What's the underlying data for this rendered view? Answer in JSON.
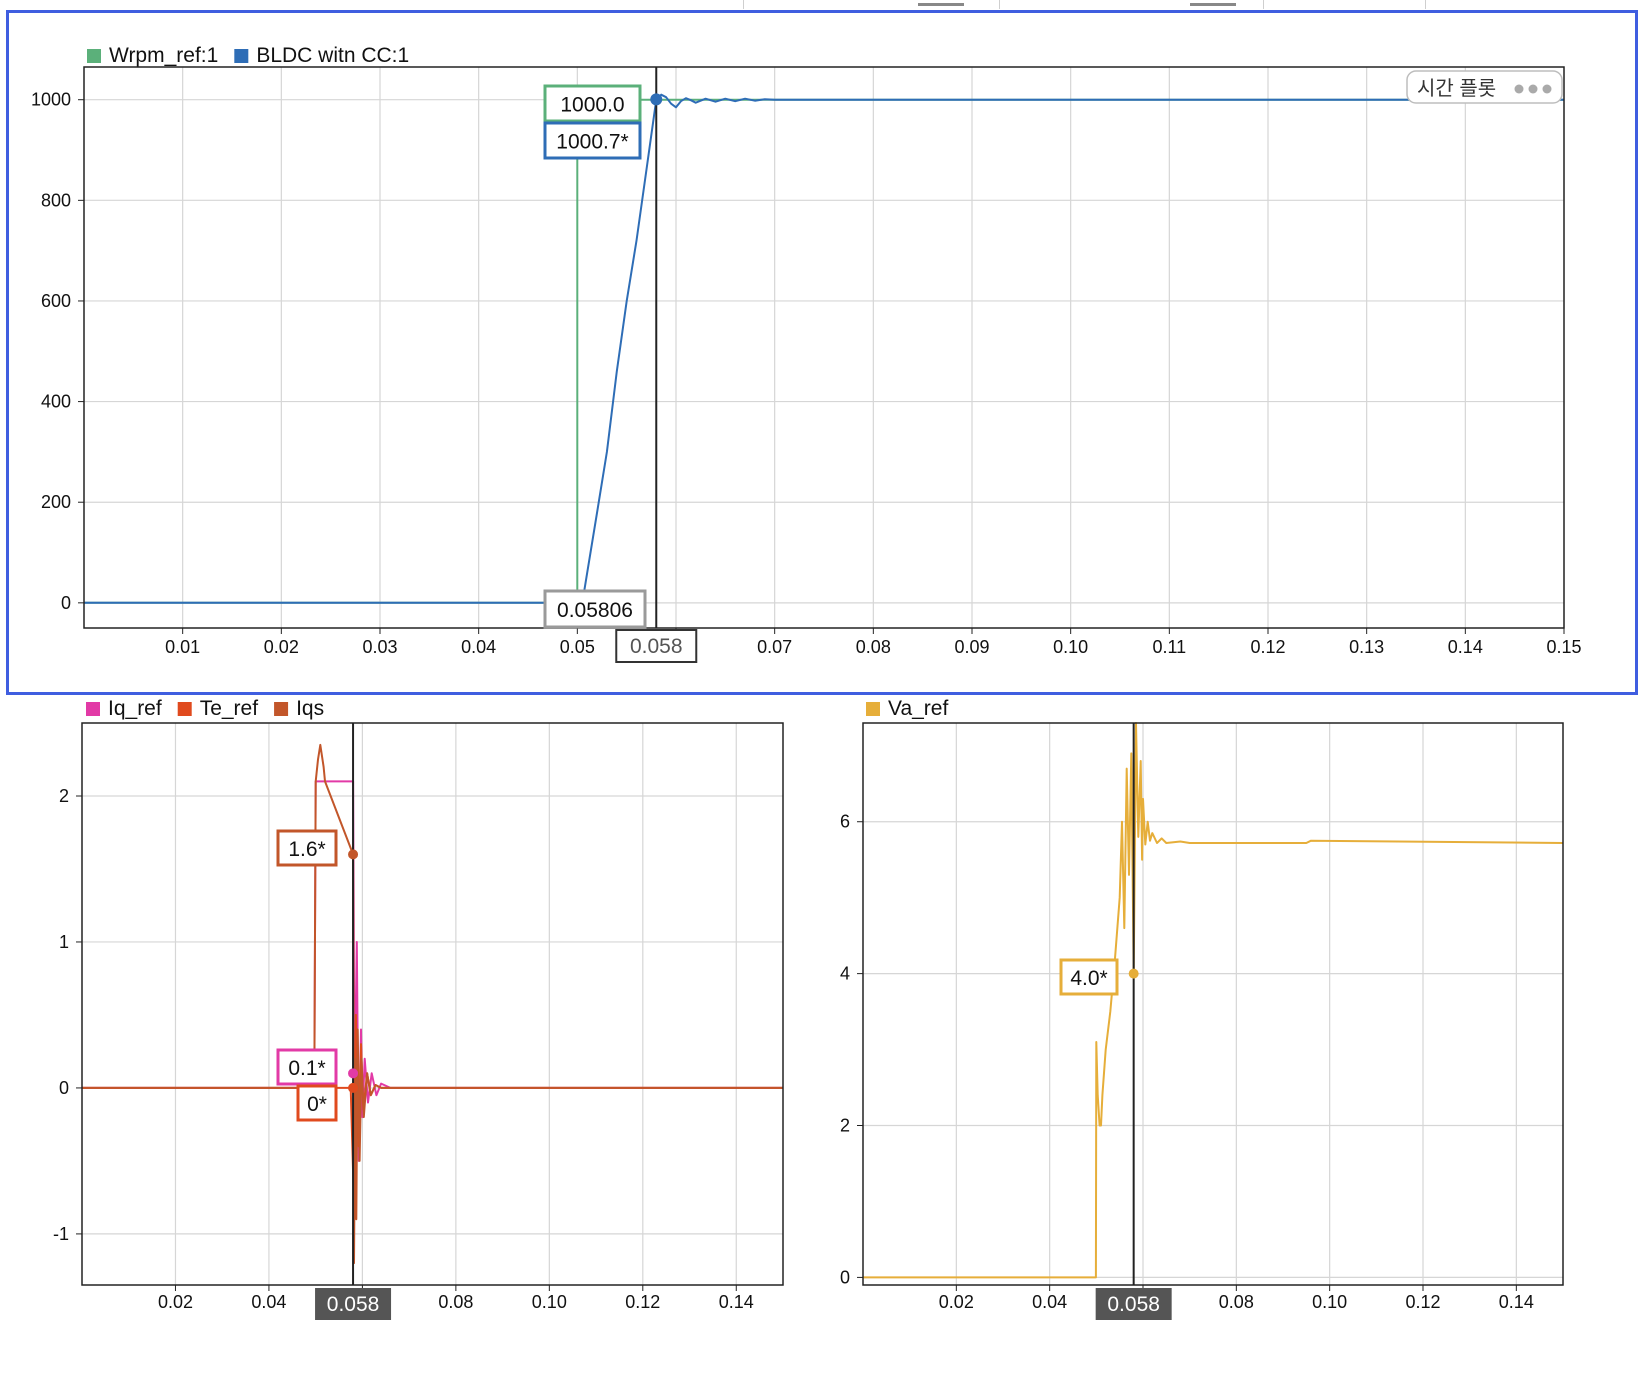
{
  "plots": [
    {
      "id": "speed",
      "legend": [
        {
          "label": "Wrpm_ref:1",
          "color": "#5bb07a"
        },
        {
          "label": "BLDC witn CC:1",
          "color": "#2e6db6"
        }
      ],
      "y_ticks": [
        "0",
        "200",
        "400",
        "600",
        "800",
        "1000"
      ],
      "x_ticks": [
        "0.01",
        "0.02",
        "0.03",
        "0.04",
        "0.05",
        "0.06",
        "0.07",
        "0.08",
        "0.09",
        "0.10",
        "0.11",
        "0.12",
        "0.13",
        "0.14",
        "0.15"
      ],
      "cursor": {
        "x": 0.058,
        "label": "0.058"
      },
      "readouts": [
        {
          "text": "1000.0",
          "color": "#5bb07a"
        },
        {
          "text": "1000.7*",
          "color": "#2e6db6"
        },
        {
          "text": "0.05806",
          "color": "#9a9a9a"
        }
      ],
      "context_menu": {
        "label": "시간 플롯",
        "icon": "more-icon"
      }
    },
    {
      "id": "current",
      "legend": [
        {
          "label": "Iq_ref",
          "color": "#e23aa6"
        },
        {
          "label": "Te_ref",
          "color": "#e04a1e"
        },
        {
          "label": "Iqs",
          "color": "#c2562a"
        }
      ],
      "y_ticks": [
        "-1",
        "0",
        "1",
        "2"
      ],
      "x_ticks": [
        "0.02",
        "0.04",
        "0.06",
        "0.08",
        "0.10",
        "0.12",
        "0.14"
      ],
      "cursor": {
        "x": 0.058,
        "label": "0.058"
      },
      "readouts": [
        {
          "text": "1.6*",
          "color": "#c2562a"
        },
        {
          "text": "0.1*",
          "color": "#e23aa6"
        },
        {
          "text": "0*",
          "color": "#e04a1e"
        }
      ]
    },
    {
      "id": "voltage",
      "legend": [
        {
          "label": "Va_ref",
          "color": "#e6ae3a"
        }
      ],
      "y_ticks": [
        "0",
        "2",
        "4",
        "6"
      ],
      "x_ticks": [
        "0.02",
        "0.04",
        "0.06",
        "0.08",
        "0.10",
        "0.12",
        "0.14"
      ],
      "cursor": {
        "x": 0.058,
        "label": "0.058"
      },
      "readouts": [
        {
          "text": "4.0*",
          "color": "#e6ae3a"
        }
      ]
    }
  ],
  "chart_data": [
    {
      "type": "line",
      "xlim": [
        0,
        0.15
      ],
      "ylim": [
        -50,
        1065
      ],
      "grid": true,
      "legend_placement": "top-left",
      "series": [
        {
          "name": "Wrpm_ref:1",
          "x": [
            0,
            0.05,
            0.05,
            0.15
          ],
          "y": [
            0,
            0,
            1000,
            1000
          ]
        },
        {
          "name": "BLDC witn CC:1",
          "x": [
            0,
            0.0505,
            0.051,
            0.052,
            0.053,
            0.054,
            0.055,
            0.056,
            0.057,
            0.058,
            0.0585,
            0.059,
            0.0595,
            0.06,
            0.0605,
            0.061,
            0.0615,
            0.062,
            0.063,
            0.064,
            0.065,
            0.066,
            0.067,
            0.068,
            0.069,
            0.07,
            0.071,
            0.15
          ],
          "y": [
            0,
            0,
            60,
            180,
            300,
            460,
            600,
            720,
            860,
            1000.7,
            1010,
            1005,
            992,
            985,
            997,
            1003,
            999,
            994,
            1002,
            996,
            1002,
            997,
            1002,
            998,
            1001,
            1000,
            1000,
            1000
          ]
        }
      ]
    },
    {
      "type": "line",
      "xlim": [
        0,
        0.15
      ],
      "ylim": [
        -1.35,
        2.5
      ],
      "grid": true,
      "legend_placement": "top-left",
      "series": [
        {
          "name": "Iq_ref",
          "x": [
            0,
            0.0497,
            0.05,
            0.058,
            0.0583,
            0.0588,
            0.0592,
            0.0597,
            0.06,
            0.0605,
            0.0612,
            0.062,
            0.063,
            0.064,
            0.066,
            0.15
          ],
          "y": [
            0,
            0,
            2.1,
            2.1,
            -0.1,
            1.0,
            -0.5,
            0.4,
            -0.2,
            0.2,
            -0.1,
            0.1,
            -0.05,
            0.03,
            0,
            0
          ]
        },
        {
          "name": "Te_ref",
          "x": [
            0,
            0.0575,
            0.0582,
            0.0586,
            0.0592,
            0.0597,
            0.0602,
            0.061,
            0.0618,
            0.0628,
            0.064,
            0.066,
            0.15
          ],
          "y": [
            0,
            0,
            -0.8,
            0.5,
            -0.4,
            0.3,
            -0.15,
            0.1,
            -0.05,
            0.02,
            0,
            0,
            0
          ]
        },
        {
          "name": "Iqs",
          "x": [
            0,
            0.0497,
            0.05,
            0.0505,
            0.051,
            0.0517,
            0.052,
            0.058,
            0.0582,
            0.0585,
            0.0587,
            0.059,
            0.0594,
            0.0598,
            0.0603,
            0.061,
            0.0618,
            0.0628,
            0.064,
            0.066,
            0.15
          ],
          "y": [
            0,
            0,
            2.1,
            2.25,
            2.35,
            2.2,
            2.1,
            1.6,
            -1.2,
            0.2,
            -0.9,
            0.4,
            -0.5,
            0.2,
            -0.2,
            0.1,
            -0.05,
            0.02,
            0,
            0,
            0
          ]
        }
      ]
    },
    {
      "type": "line",
      "xlim": [
        0,
        0.15
      ],
      "ylim": [
        -0.1,
        7.3
      ],
      "grid": true,
      "legend_placement": "top-left",
      "series": [
        {
          "name": "Va_ref",
          "x": [
            0,
            0.0499,
            0.05,
            0.0503,
            0.0507,
            0.051,
            0.0513,
            0.052,
            0.053,
            0.054,
            0.055,
            0.0555,
            0.056,
            0.0565,
            0.057,
            0.0575,
            0.058,
            0.0585,
            0.059,
            0.0595,
            0.0598,
            0.06,
            0.0605,
            0.061,
            0.0615,
            0.062,
            0.063,
            0.064,
            0.065,
            0.068,
            0.07,
            0.08,
            0.095,
            0.096,
            0.15
          ],
          "y": [
            0,
            0,
            3.1,
            2.4,
            2.0,
            2.0,
            2.4,
            3.0,
            3.5,
            4.2,
            5.0,
            6.0,
            4.6,
            6.7,
            5.3,
            6.9,
            4.0,
            7.3,
            5.8,
            6.8,
            5.5,
            6.3,
            5.7,
            6.0,
            5.75,
            5.85,
            5.72,
            5.78,
            5.72,
            5.74,
            5.72,
            5.72,
            5.72,
            5.75,
            5.72
          ]
        }
      ]
    }
  ]
}
